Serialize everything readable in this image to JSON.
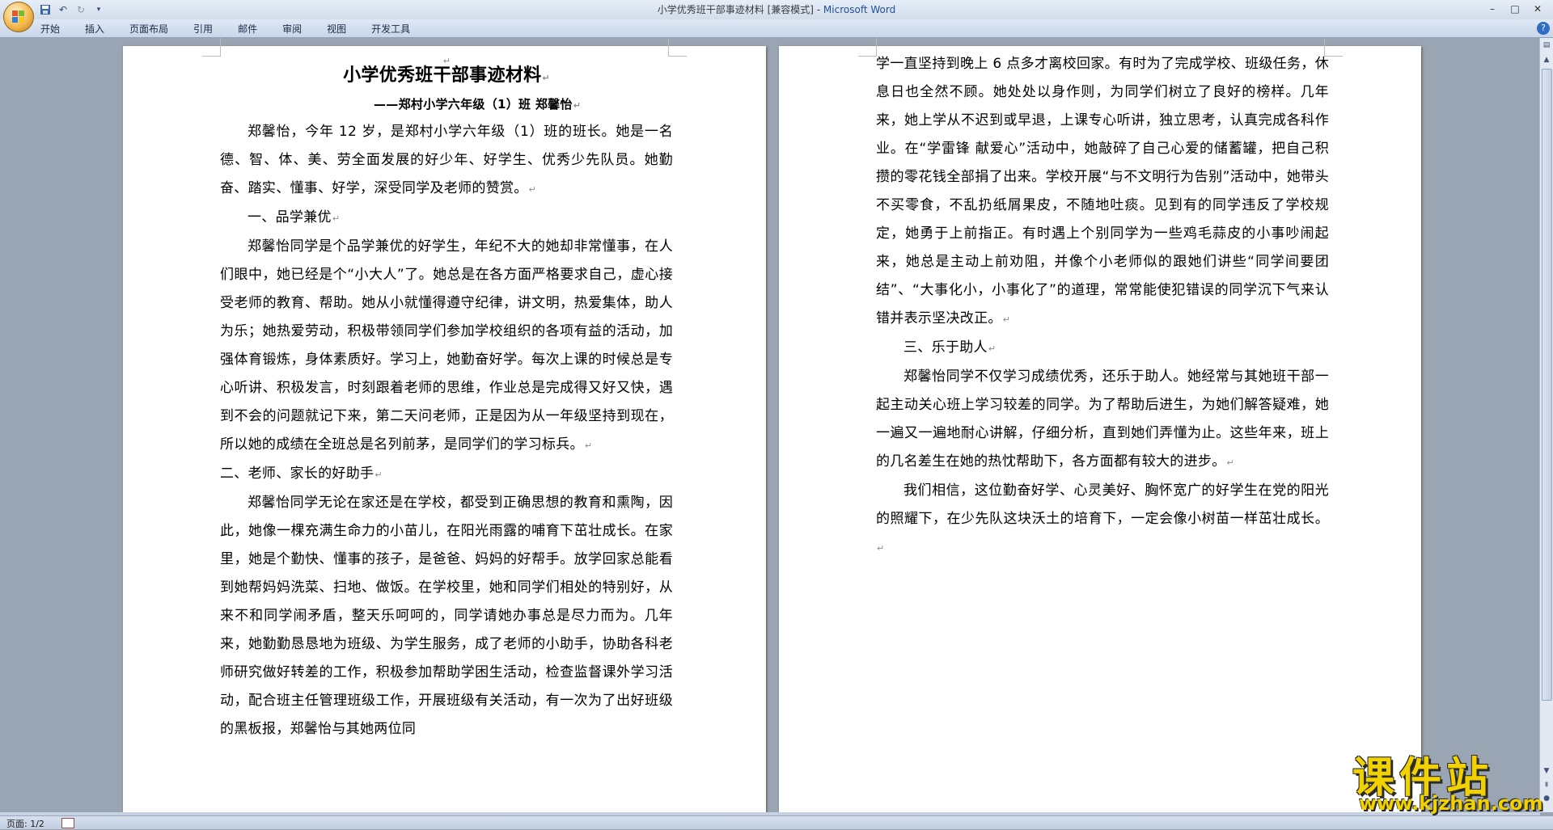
{
  "window": {
    "title": "小学优秀班干部事迹材料 [兼容模式] - ",
    "app_name": "Microsoft Word",
    "controls": [
      "–",
      "□",
      "✕"
    ]
  },
  "ribbon": {
    "tabs": [
      "开始",
      "插入",
      "页面布局",
      "引用",
      "邮件",
      "审阅",
      "视图",
      "开发工具"
    ],
    "help": "?"
  },
  "page1": {
    "title": "小学优秀班干部事迹材料",
    "subtitle": "——郑村小学六年级（1）班 郑馨怡",
    "p1": "郑馨怡，今年 12 岁，是郑村小学六年级（1）班的班长。她是一名德、智、体、美、劳全面发展的好少年、好学生、优秀少先队员。她勤奋、踏实、懂事、好学，深受同学及老师的赞赏。",
    "h1": "一、品学兼优",
    "p2": "郑馨怡同学是个品学兼优的好学生，年纪不大的她却非常懂事，在人们眼中，她已经是个“小大人”了。她总是在各方面严格要求自己，虚心接受老师的教育、帮助。她从小就懂得遵守纪律，讲文明，热爱集体，助人为乐；她热爱劳动，积极带领同学们参加学校组织的各项有益的活动，加强体育锻炼，身体素质好。学习上，她勤奋好学。每次上课的时候总是专心听讲、积极发言，时刻跟着老师的思维，作业总是完成得又好又快，遇到不会的问题就记下来，第二天问老师，正是因为从一年级坚持到现在，所以她的成绩在全班总是名列前茅，是同学们的学习标兵。",
    "h2": "二、老师、家长的好助手",
    "p3": "郑馨怡同学无论在家还是在学校，都受到正确思想的教育和熏陶，因此，她像一棵充满生命力的小苗儿，在阳光雨露的哺育下茁壮成长。在家里，她是个勤快、懂事的孩子，是爸爸、妈妈的好帮手。放学回家总能看到她帮妈妈洗菜、扫地、做饭。在学校里，她和同学们相处的特别好，从来不和同学闹矛盾，整天乐呵呵的，同学请她办事总是尽力而为。几年来，她勤勤恳恳地为班级、为学生服务，成了老师的小助手，协助各科老师研究做好转差的工作，积极参加帮助学困生活动，检查监督课外学习活动，配合班主任管理班级工作，开展班级有关活动，有一次为了出好班级的黑板报，郑馨怡与其她两位同"
  },
  "page2": {
    "p1": "学一直坚持到晚上 6 点多才离校回家。有时为了完成学校、班级任务，休息日也全然不顾。她处处以身作则，为同学们树立了良好的榜样。几年来，她上学从不迟到或早退，上课专心听讲，独立思考，认真完成各科作业。在“学雷锋 献爱心”活动中，她敲碎了自己心爱的储蓄罐，把自己积攒的零花钱全部捐了出来。学校开展“与不文明行为告别”活动中，她带头不买零食，不乱扔纸屑果皮，不随地吐痰。见到有的同学违反了学校规定，她勇于上前指正。有时遇上个别同学为一些鸡毛蒜皮的小事吵闹起来，她总是主动上前劝阻，并像个小老师似的跟她们讲些“同学间要团结”、“大事化小，小事化了”的道理，常常能使犯错误的同学沉下气来认错并表示坚决改正。",
    "h3": "三、乐于助人",
    "p2": "郑馨怡同学不仅学习成绩优秀，还乐于助人。她经常与其她班干部一起主动关心班上学习较差的同学。为了帮助后进生，为她们解答疑难，她一遍又一遍地耐心讲解，仔细分析，直到她们弄懂为止。这些年来，班上的几名差生在她的热忱帮助下，各方面都有较大的进步。",
    "p3": "我们相信，这位勤奋好学、心灵美好、胸怀宽广的好学生在党的阳光的照耀下，在少先队这块沃土的培育下，一定会像小树苗一样茁壮成长。"
  },
  "marks": {
    "para": "↵"
  },
  "status": {
    "page": "页面: 1/2"
  },
  "watermark": {
    "text": "课件站",
    "url": "www.kjzhan.com"
  }
}
